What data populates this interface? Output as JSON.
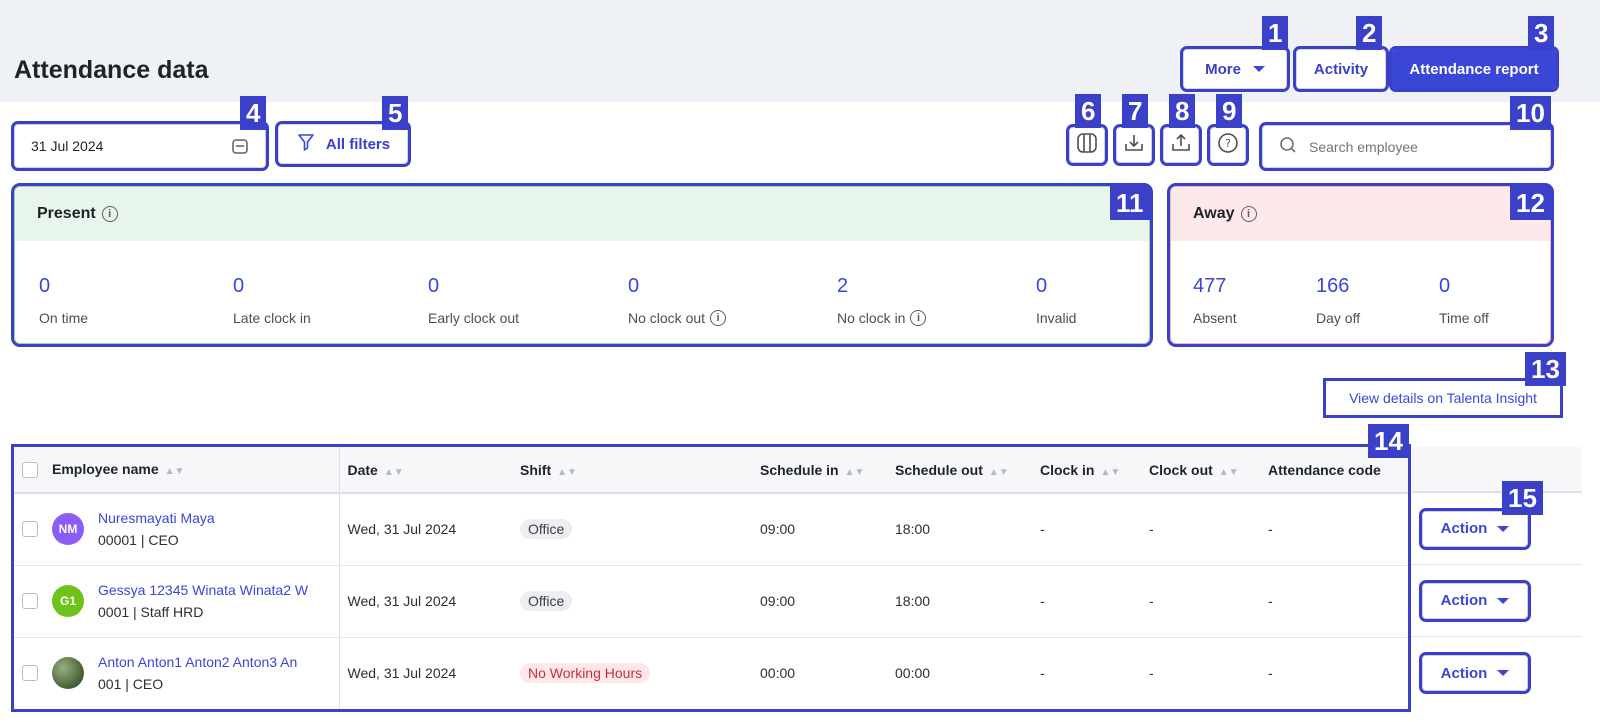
{
  "page": {
    "title": "Attendance data"
  },
  "header_buttons": {
    "more": "More",
    "activity": "Activity",
    "report": "Attendance report"
  },
  "filters": {
    "date": "31 Jul 2024",
    "all_filters": "All filters"
  },
  "search": {
    "placeholder": "Search employee"
  },
  "present": {
    "title": "Present",
    "stats": [
      {
        "value": "0",
        "label": "On time"
      },
      {
        "value": "0",
        "label": "Late clock in"
      },
      {
        "value": "0",
        "label": "Early clock out"
      },
      {
        "value": "0",
        "label": "No clock out"
      },
      {
        "value": "2",
        "label": "No clock in"
      },
      {
        "value": "0",
        "label": "Invalid"
      }
    ]
  },
  "away": {
    "title": "Away",
    "stats": [
      {
        "value": "477",
        "label": "Absent"
      },
      {
        "value": "166",
        "label": "Day off"
      },
      {
        "value": "0",
        "label": "Time off"
      }
    ]
  },
  "insight_link": "View details on Talenta Insight",
  "table": {
    "columns": [
      "Employee name",
      "Date",
      "Shift",
      "Schedule in",
      "Schedule out",
      "Clock in",
      "Clock out",
      "Attendance code"
    ],
    "rows": [
      {
        "initials": "NM",
        "avatar_color": "#8b5cf6",
        "name": "Nuresmayati Maya",
        "sub": "00001 | CEO",
        "date": "Wed, 31 Jul 2024",
        "shift": "Office",
        "sched_in": "09:00",
        "sched_out": "18:00",
        "clock_in": "-",
        "clock_out": "-",
        "code": "-"
      },
      {
        "initials": "G1",
        "avatar_color": "#6fc21a",
        "name": "Gessya 12345 Winata Winata2 W",
        "sub": "0001 | Staff HRD",
        "date": "Wed, 31 Jul 2024",
        "shift": "Office",
        "sched_in": "09:00",
        "sched_out": "18:00",
        "clock_in": "-",
        "clock_out": "-",
        "code": "-"
      },
      {
        "initials": "",
        "avatar_color": "#6b7f5a",
        "name": "Anton Anton1 Anton2 Anton3 An",
        "sub": "001 | CEO",
        "date": "Wed, 31 Jul 2024",
        "shift": "No Working Hours",
        "sched_in": "00:00",
        "sched_out": "00:00",
        "clock_in": "-",
        "clock_out": "-",
        "code": "-"
      }
    ]
  },
  "action_label": "Action",
  "badges": [
    "1",
    "2",
    "3",
    "4",
    "5",
    "6",
    "7",
    "8",
    "9",
    "10",
    "11",
    "12",
    "13",
    "14",
    "15"
  ],
  "colors": {
    "accent": "#3a46d6",
    "present_bg": "#e7f5ea",
    "away_bg": "#fde8ea",
    "annotation": "#3a40c8"
  }
}
